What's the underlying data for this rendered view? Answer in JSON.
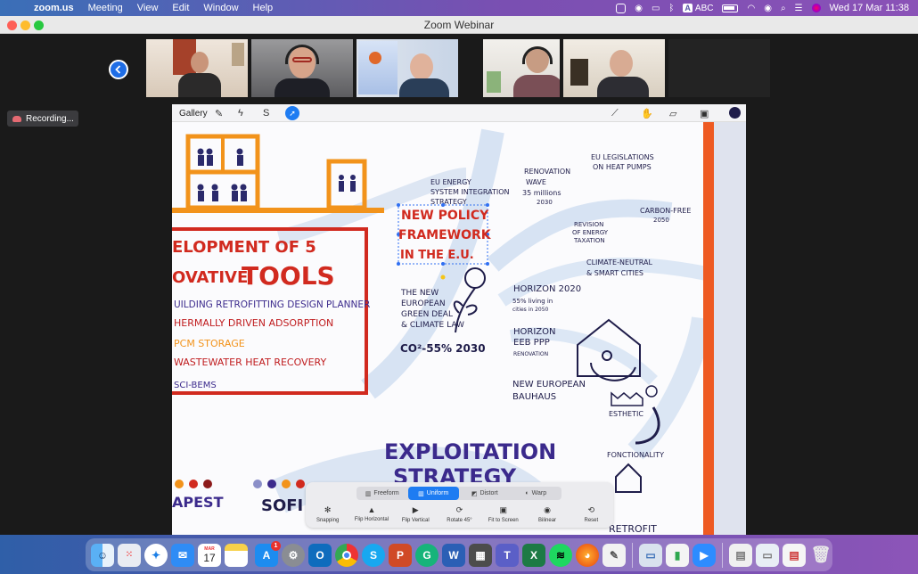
{
  "menubar": {
    "app_name": "zoom.us",
    "menus": [
      "Meeting",
      "View",
      "Edit",
      "Window",
      "Help"
    ],
    "input_source": "ABC",
    "clock": "Wed 17 Mar  11:38"
  },
  "window": {
    "title": "Zoom Webinar"
  },
  "recording": {
    "label": "Recording..."
  },
  "ipad_toolbar": {
    "gallery_label": "Gallery"
  },
  "sketch": {
    "headline_1": "ELOPMENT OF 5",
    "headline_2a": "OVATIVE",
    "headline_2b": "TOOLS",
    "tool_list": [
      "UILDING RETROFITTING DESIGN PLANNER",
      "HERMALLY DRIVEN ADSORPTION",
      "PCM STORAGE",
      "WASTEWATER HEAT RECOVERY",
      "SCI-BEMS"
    ],
    "eu_energy": [
      "EU ENERGY",
      "SYSTEM INTEGRATION",
      "STRATEGY"
    ],
    "new_policy": [
      "NEW POLICY",
      "FRAMEWORK",
      "IN THE E.U."
    ],
    "renovation": [
      "RENOVATION",
      "WAVE",
      "35 millions",
      "2030"
    ],
    "eu_legislations": [
      "EU LEGISLATIONS",
      "ON HEAT PUMPS"
    ],
    "carbon_free": [
      "CARBON-FREE",
      "2050"
    ],
    "revision": [
      "REVISION",
      "OF ENERGY",
      "TAXATION"
    ],
    "climate_neutral": [
      "CLIMATE-NEUTRAL",
      "& SMART CITIES"
    ],
    "green_deal": [
      "THE NEW",
      "EUROPEAN",
      "GREEN DEAL",
      "& CLIMATE LAW"
    ],
    "co2": "CO²-55% 2030",
    "horizon2020": [
      "HORIZON 2020",
      "55% living in",
      "cities in 2050"
    ],
    "horizon_eeb": [
      "HORIZON",
      "EEB PPP",
      "RENOVATION"
    ],
    "bauhaus": [
      "NEW EUROPEAN",
      "BAUHAUS"
    ],
    "esthetic": "ESTHETIC",
    "fonctionality": "FONCTIONALITY",
    "exploitation": [
      "EXPLOITATION",
      "STRATEGY"
    ],
    "city_1": "APEST",
    "city_2": "SOFI",
    "retrofit": "RETROFIT"
  },
  "transform": {
    "modes": [
      "Freeform",
      "Uniform",
      "Distort",
      "Warp"
    ],
    "active_mode": "Uniform",
    "actions": [
      "Snapping",
      "Flip Horizontal",
      "Flip Vertical",
      "Rotate 45°",
      "Fit to Screen",
      "Bilinear",
      "Reset"
    ]
  },
  "dock": {
    "app_store_badge": "1",
    "calendar_month": "MAR",
    "calendar_day": "17"
  },
  "colors": {
    "accent_blue": "#1e6de6",
    "sketch_orange": "#f2931b",
    "sketch_red": "#d12a1f",
    "sketch_purple": "#3b2a8c",
    "sketch_navy": "#1f1d4a"
  }
}
